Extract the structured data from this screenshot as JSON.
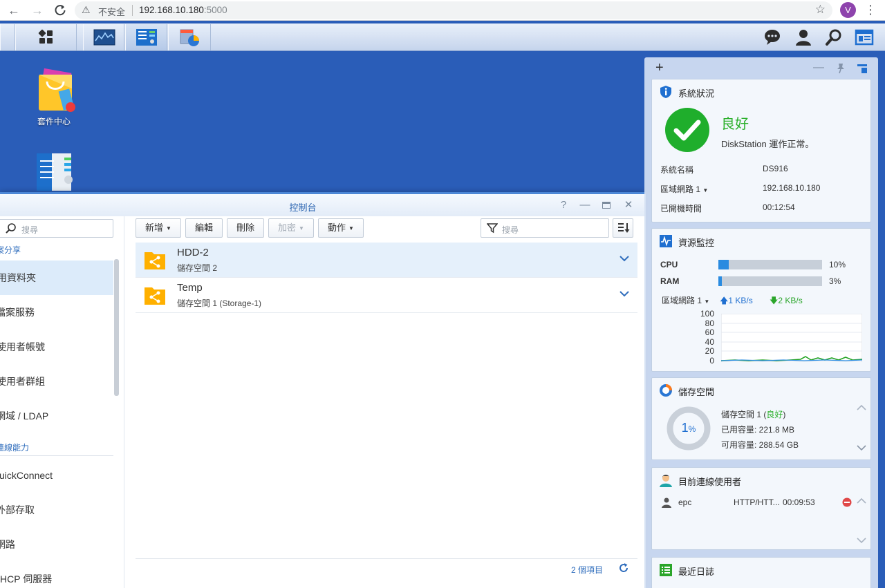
{
  "browser": {
    "security_label": "不安全",
    "url_host": "192.168.10.180",
    "url_port": ":5000",
    "profile_initial": "V"
  },
  "desktop": {
    "icons": [
      {
        "label": "套件中心",
        "icon": "package-center-icon"
      },
      {
        "label": "",
        "icon": "control-panel-icon"
      }
    ]
  },
  "control_panel": {
    "title": "控制台",
    "sidebar": {
      "search_placeholder": "搜尋",
      "section_1": "案分享",
      "items_1": [
        "用資料夾",
        "檔案服務",
        "使用者帳號",
        "使用者群組",
        "網域 / LDAP"
      ],
      "section_2": "連線能力",
      "items_2": [
        "uickConnect",
        "外部存取",
        "網路",
        "HCP 伺服器"
      ]
    },
    "toolbar": {
      "create": "新增",
      "edit": "編輯",
      "delete": "刪除",
      "encrypt": "加密",
      "action": "動作",
      "filter_placeholder": "搜尋"
    },
    "shares": [
      {
        "name": "HDD-2",
        "location": "儲存空間 2"
      },
      {
        "name": "Temp",
        "location": "儲存空間 1 (Storage-1)"
      }
    ],
    "footer": {
      "count": "2 個項目"
    }
  },
  "widgets": {
    "system_health": {
      "title": "系統狀況",
      "status": "良好",
      "status_detail": "DiskStation 運作正常。",
      "rows": [
        {
          "label": "系統名稱",
          "value": "DS916"
        },
        {
          "label": "區域網路 1",
          "value": "192.168.10.180"
        },
        {
          "label": "已開機時間",
          "value": "00:12:54"
        }
      ],
      "status_color": "#2bb02b"
    },
    "resource_monitor": {
      "title": "資源監控",
      "cpu_label": "CPU",
      "cpu_value": "10%",
      "cpu_fraction": 0.1,
      "ram_label": "RAM",
      "ram_value": "3%",
      "ram_fraction": 0.03,
      "lan_label": "區域網路 1",
      "upload": "1 KB/s",
      "download": "2 KB/s",
      "y_ticks": [
        "100",
        "80",
        "60",
        "40",
        "20",
        "0"
      ]
    },
    "storage": {
      "title": "儲存空間",
      "percent": "1",
      "percent_unit": "%",
      "volume_name": "儲存空間 1",
      "volume_status": "良好",
      "used": "已用容量: 221.8 MB",
      "available": "可用容量: 288.54 GB"
    },
    "connected_users": {
      "title": "目前連線使用者",
      "user": "epc",
      "protocol": "HTTP/HTT...",
      "duration": "00:09:53"
    },
    "recent_logs": {
      "title": "最近日誌"
    }
  }
}
